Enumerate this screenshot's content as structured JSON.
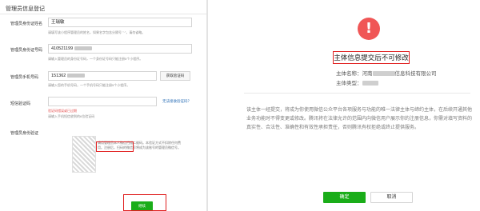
{
  "left": {
    "title": "管理员信息登记",
    "name": {
      "label": "管理员身份证姓名",
      "value": "王瑞敏",
      "hint": "请填写该小程序管理员的姓名，如果名字包含分隔号 \"·\"，请勿省略。"
    },
    "id_number": {
      "label": "管理员身份证号码",
      "value": "410521199",
      "hint": "请输入管理员的身份证号码，一个身份证号码只能注册5个小程序。"
    },
    "phone": {
      "label": "管理员手机号码",
      "value": "151362",
      "hint": "请输入您的手机号码，一个手机号码只能注册5个小程序。",
      "get_code_button": "获取验证码"
    },
    "sms": {
      "label": "短信验证码",
      "error": "验证码错误或已过期",
      "hint": "请输入手机短信收到的6位验证码",
      "no_code_link": "无法接收验证码？"
    },
    "verify": {
      "label": "管理员身份验证",
      "qr_text": "请用管理员本人微信扫描二维码。本验证方式不扣除任何费用。注册后，扫码的微信号将成为该账号的管理员微信号。"
    },
    "next_button": "继续"
  },
  "right": {
    "warning_icon": "exclamation-icon",
    "heading": "主体信息提交后不可修改",
    "subject_name_label": "主体名称：",
    "subject_name_prefix": "河南",
    "subject_name_suffix": "信息科技有限公司",
    "subject_type_label": "主体类型：",
    "notice": "该主体一经提交，将成为你使用微信公众平台各项服务与功能的唯一法律主体与缔约主体，在后续开通其他业务功能时不得变更或修改。腾讯将在法律允许的范围内向微信用户展示你的注册信息，你需对填写资料的真实性、合法性、准确性和有效性承担责任，否则腾讯有权拒绝或终止提供服务。",
    "ok_button": "确定",
    "cancel_button": "取消"
  },
  "colors": {
    "primary_green": "#1aad19",
    "highlight_red": "#e02020",
    "warning_red": "#f05656",
    "link_blue": "#2b6fb6"
  }
}
